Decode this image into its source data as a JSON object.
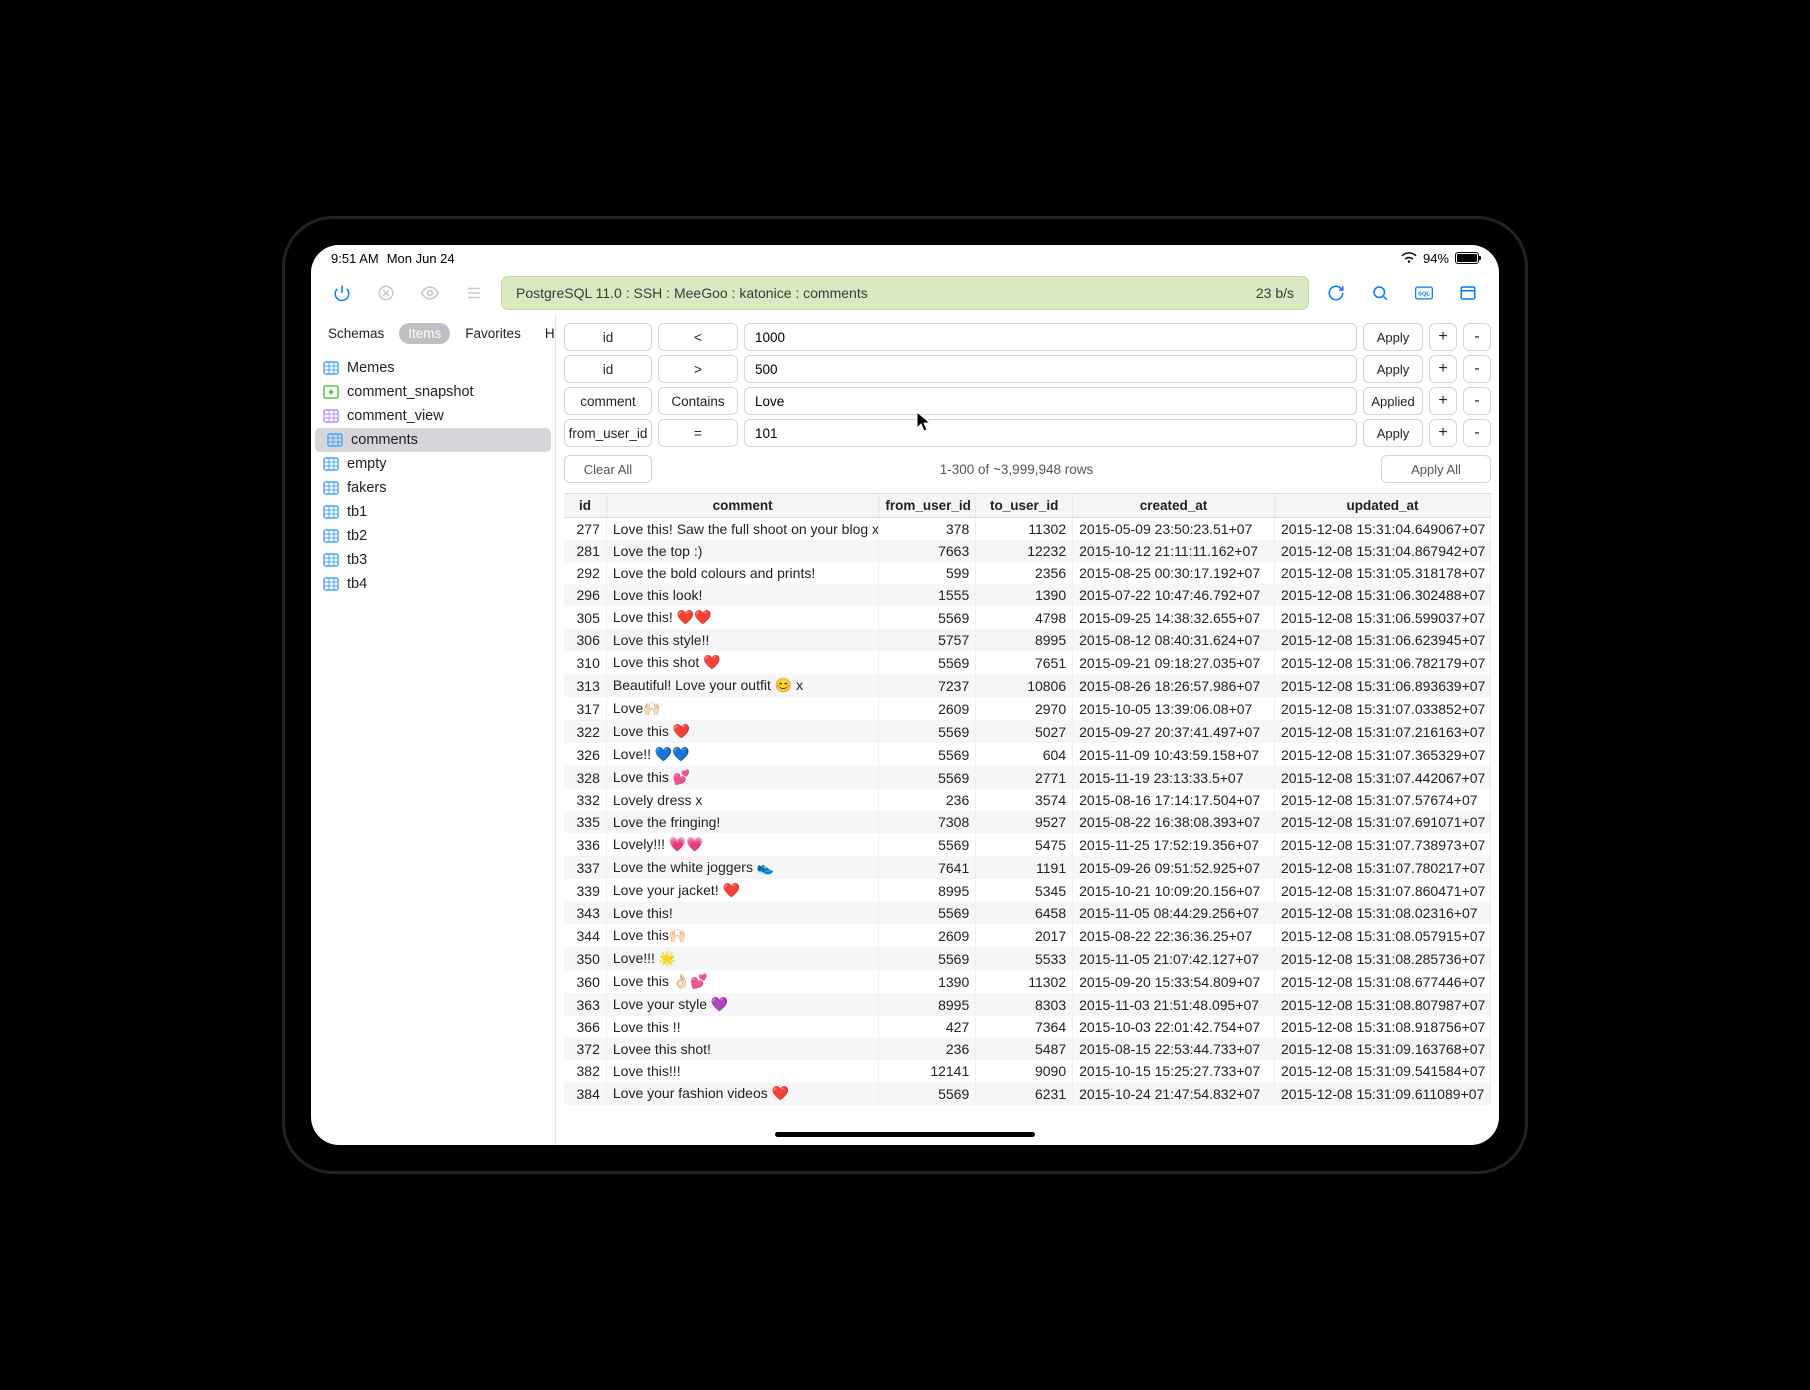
{
  "status": {
    "time": "9:51 AM",
    "date": "Mon Jun 24",
    "battery_pct": "94%"
  },
  "toolbar": {
    "breadcrumb": "PostgreSQL 11.0 : SSH : MeeGoo : katonice : comments",
    "rate": "23 b/s"
  },
  "sidebar": {
    "tabs": [
      "Schemas",
      "Items",
      "Favorites",
      "History"
    ],
    "active_tab_index": 1,
    "items": [
      {
        "name": "Memes",
        "type": "table"
      },
      {
        "name": "comment_snapshot",
        "type": "snapshot"
      },
      {
        "name": "comment_view",
        "type": "view"
      },
      {
        "name": "comments",
        "type": "table",
        "selected": true
      },
      {
        "name": "empty",
        "type": "table"
      },
      {
        "name": "fakers",
        "type": "table"
      },
      {
        "name": "tb1",
        "type": "table"
      },
      {
        "name": "tb2",
        "type": "table"
      },
      {
        "name": "tb3",
        "type": "table"
      },
      {
        "name": "tb4",
        "type": "table"
      }
    ]
  },
  "filters": [
    {
      "column": "id",
      "op": "<",
      "value": "1000",
      "apply_label": "Apply"
    },
    {
      "column": "id",
      "op": ">",
      "value": "500",
      "apply_label": "Apply"
    },
    {
      "column": "comment",
      "op": "Contains",
      "value": "Love",
      "apply_label": "Applied"
    },
    {
      "column": "from_user_id",
      "op": "=",
      "value": "101",
      "apply_label": "Apply"
    }
  ],
  "controls": {
    "clear_all": "Clear All",
    "summary": "1-300 of ~3,999,948 rows",
    "apply_all": "Apply All"
  },
  "columns": [
    "id",
    "comment",
    "from_user_id",
    "to_user_id",
    "created_at",
    "updated_at"
  ],
  "rows": [
    {
      "id": 277,
      "comment": "Love this! Saw the full shoot on your blog x",
      "from_user_id": 378,
      "to_user_id": 11302,
      "created_at": "2015-05-09 23:50:23.51+07",
      "updated_at": "2015-12-08 15:31:04.649067+07"
    },
    {
      "id": 281,
      "comment": "Love the top :)",
      "from_user_id": 7663,
      "to_user_id": 12232,
      "created_at": "2015-10-12 21:11:11.162+07",
      "updated_at": "2015-12-08 15:31:04.867942+07"
    },
    {
      "id": 292,
      "comment": "Love the bold colours and prints!",
      "from_user_id": 599,
      "to_user_id": 2356,
      "created_at": "2015-08-25 00:30:17.192+07",
      "updated_at": "2015-12-08 15:31:05.318178+07"
    },
    {
      "id": 296,
      "comment": "Love this look!",
      "from_user_id": 1555,
      "to_user_id": 1390,
      "created_at": "2015-07-22 10:47:46.792+07",
      "updated_at": "2015-12-08 15:31:06.302488+07"
    },
    {
      "id": 305,
      "comment": "Love this! ❤️❤️",
      "from_user_id": 5569,
      "to_user_id": 4798,
      "created_at": "2015-09-25 14:38:32.655+07",
      "updated_at": "2015-12-08 15:31:06.599037+07"
    },
    {
      "id": 306,
      "comment": "Love this style!!",
      "from_user_id": 5757,
      "to_user_id": 8995,
      "created_at": "2015-08-12 08:40:31.624+07",
      "updated_at": "2015-12-08 15:31:06.623945+07"
    },
    {
      "id": 310,
      "comment": "Love this shot ❤️",
      "from_user_id": 5569,
      "to_user_id": 7651,
      "created_at": "2015-09-21 09:18:27.035+07",
      "updated_at": "2015-12-08 15:31:06.782179+07"
    },
    {
      "id": 313,
      "comment": "Beautiful! Love your outfit 😊 x",
      "from_user_id": 7237,
      "to_user_id": 10806,
      "created_at": "2015-08-26 18:26:57.986+07",
      "updated_at": "2015-12-08 15:31:06.893639+07"
    },
    {
      "id": 317,
      "comment": " Love🙌🏻",
      "from_user_id": 2609,
      "to_user_id": 2970,
      "created_at": "2015-10-05 13:39:06.08+07",
      "updated_at": "2015-12-08 15:31:07.033852+07"
    },
    {
      "id": 322,
      "comment": "Love this ❤️",
      "from_user_id": 5569,
      "to_user_id": 5027,
      "created_at": "2015-09-27 20:37:41.497+07",
      "updated_at": "2015-12-08 15:31:07.216163+07"
    },
    {
      "id": 326,
      "comment": "Love!! 💙💙",
      "from_user_id": 5569,
      "to_user_id": 604,
      "created_at": "2015-11-09 10:43:59.158+07",
      "updated_at": "2015-12-08 15:31:07.365329+07"
    },
    {
      "id": 328,
      "comment": "Love this 💕",
      "from_user_id": 5569,
      "to_user_id": 2771,
      "created_at": "2015-11-19 23:13:33.5+07",
      "updated_at": "2015-12-08 15:31:07.442067+07"
    },
    {
      "id": 332,
      "comment": "Lovely dress x",
      "from_user_id": 236,
      "to_user_id": 3574,
      "created_at": "2015-08-16 17:14:17.504+07",
      "updated_at": "2015-12-08 15:31:07.57674+07"
    },
    {
      "id": 335,
      "comment": "Love the fringing!",
      "from_user_id": 7308,
      "to_user_id": 9527,
      "created_at": "2015-08-22 16:38:08.393+07",
      "updated_at": "2015-12-08 15:31:07.691071+07"
    },
    {
      "id": 336,
      "comment": "Lovely!!! 💗💗",
      "from_user_id": 5569,
      "to_user_id": 5475,
      "created_at": "2015-11-25 17:52:19.356+07",
      "updated_at": "2015-12-08 15:31:07.738973+07"
    },
    {
      "id": 337,
      "comment": "Love the white joggers 👟",
      "from_user_id": 7641,
      "to_user_id": 1191,
      "created_at": "2015-09-26 09:51:52.925+07",
      "updated_at": "2015-12-08 15:31:07.780217+07"
    },
    {
      "id": 339,
      "comment": "Love your jacket! ❤️",
      "from_user_id": 8995,
      "to_user_id": 5345,
      "created_at": "2015-10-21 10:09:20.156+07",
      "updated_at": "2015-12-08 15:31:07.860471+07"
    },
    {
      "id": 343,
      "comment": "Love this!",
      "from_user_id": 5569,
      "to_user_id": 6458,
      "created_at": "2015-11-05 08:44:29.256+07",
      "updated_at": "2015-12-08 15:31:08.02316+07"
    },
    {
      "id": 344,
      "comment": "Love this🙌🏻",
      "from_user_id": 2609,
      "to_user_id": 2017,
      "created_at": "2015-08-22 22:36:36.25+07",
      "updated_at": "2015-12-08 15:31:08.057915+07"
    },
    {
      "id": 350,
      "comment": "Love!!! 🌟",
      "from_user_id": 5569,
      "to_user_id": 5533,
      "created_at": "2015-11-05 21:07:42.127+07",
      "updated_at": "2015-12-08 15:31:08.285736+07"
    },
    {
      "id": 360,
      "comment": "Love this 👌🏻💕",
      "from_user_id": 1390,
      "to_user_id": 11302,
      "created_at": "2015-09-20 15:33:54.809+07",
      "updated_at": "2015-12-08 15:31:08.677446+07"
    },
    {
      "id": 363,
      "comment": "Love your style 💜",
      "from_user_id": 8995,
      "to_user_id": 8303,
      "created_at": "2015-11-03 21:51:48.095+07",
      "updated_at": "2015-12-08 15:31:08.807987+07"
    },
    {
      "id": 366,
      "comment": "Love this !!",
      "from_user_id": 427,
      "to_user_id": 7364,
      "created_at": "2015-10-03 22:01:42.754+07",
      "updated_at": "2015-12-08 15:31:08.918756+07"
    },
    {
      "id": 372,
      "comment": "Lovee this shot!",
      "from_user_id": 236,
      "to_user_id": 5487,
      "created_at": "2015-08-15 22:53:44.733+07",
      "updated_at": "2015-12-08 15:31:09.163768+07"
    },
    {
      "id": 382,
      "comment": "Love this!!!",
      "from_user_id": 12141,
      "to_user_id": 9090,
      "created_at": "2015-10-15 15:25:27.733+07",
      "updated_at": "2015-12-08 15:31:09.541584+07"
    },
    {
      "id": 384,
      "comment": "Love your fashion videos ❤️",
      "from_user_id": 5569,
      "to_user_id": 6231,
      "created_at": "2015-10-24 21:47:54.832+07",
      "updated_at": "2015-12-08 15:31:09.611089+07"
    }
  ]
}
